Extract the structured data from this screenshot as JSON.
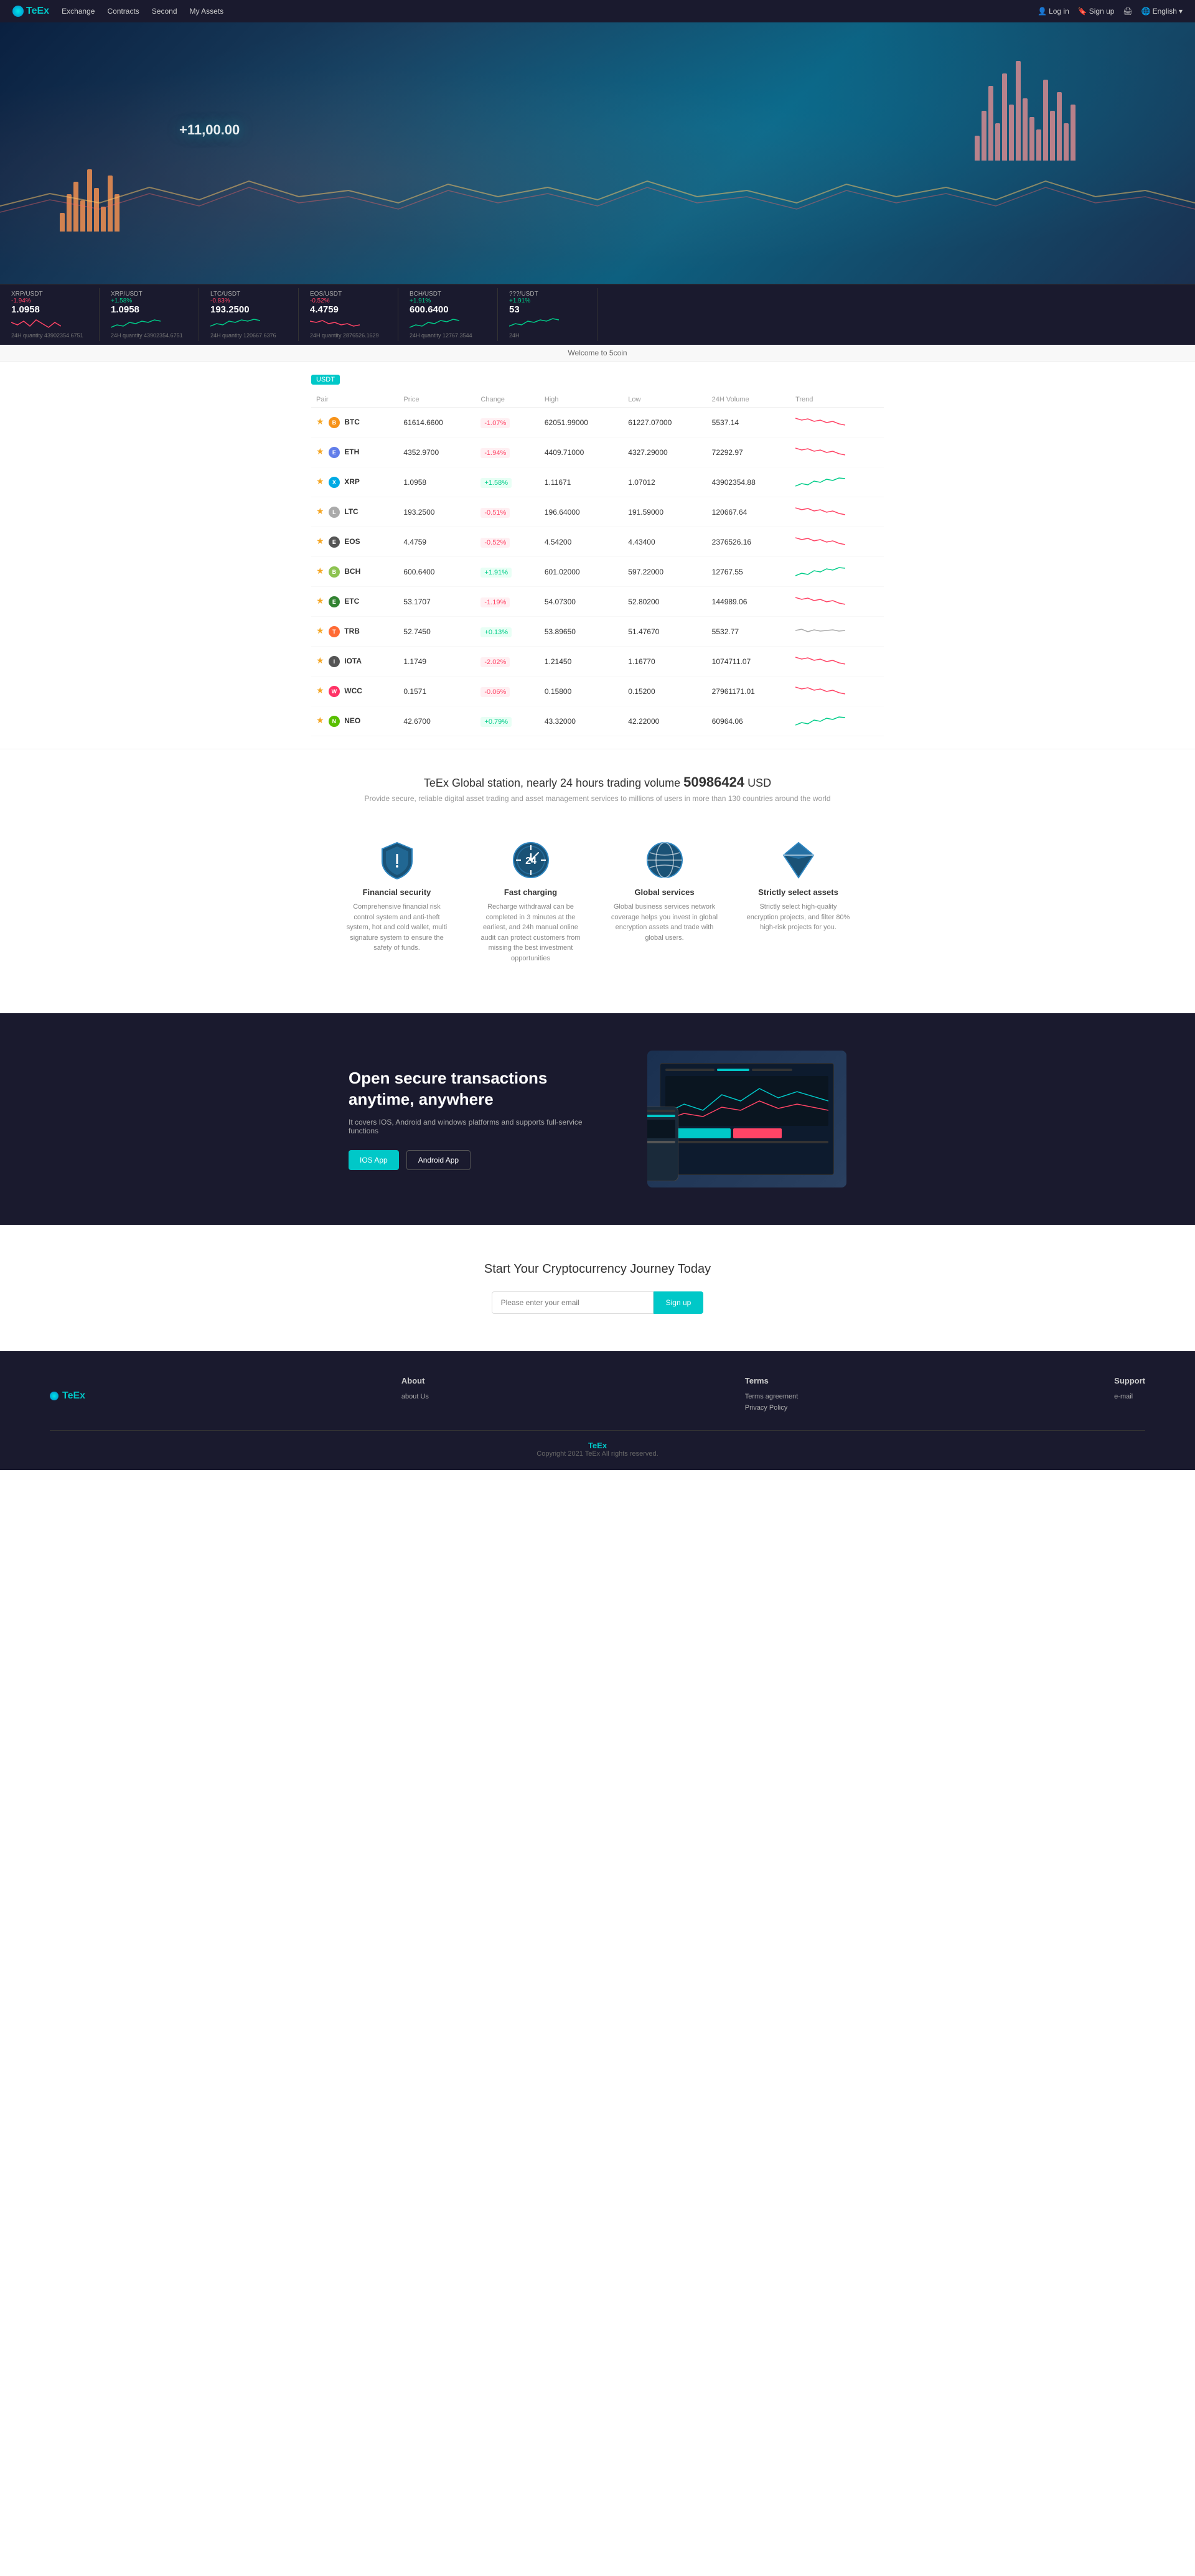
{
  "nav": {
    "logo": "TeEx",
    "links": [
      "Exchange",
      "Contracts",
      "Second",
      "My Assets"
    ],
    "login": "Log in",
    "signup": "Sign up",
    "lang": "English"
  },
  "hero": {
    "price_tag": "+11,00.00"
  },
  "ticker": [
    {
      "pair": "XRP/USDT",
      "change": "-1.94%",
      "price": "1.0958",
      "vol": "24H quantity 43902354.6751",
      "positive": false
    },
    {
      "pair": "XRP/USDT",
      "change": "+1.58%",
      "price": "1.0958",
      "vol": "24H quantity 43902354.6751",
      "positive": true
    },
    {
      "pair": "LTC/USDT",
      "change": "-0.83%",
      "price": "193.2500",
      "vol": "24H quantity 120667.6376",
      "positive": false
    },
    {
      "pair": "EOS/USDT",
      "change": "-0.52%",
      "price": "4.4759",
      "vol": "24H quantity 2876526.1629",
      "positive": false
    },
    {
      "pair": "BCH/USDT",
      "change": "+1.91%",
      "price": "600.6400",
      "vol": "24H quantity 12767.3544",
      "positive": true
    },
    {
      "pair": "???",
      "change": "+1.91%",
      "price": "53",
      "vol": "24H",
      "positive": true
    }
  ],
  "welcome": "Welcome to 5coin",
  "market": {
    "tab": "USDT",
    "headers": [
      "Pair",
      "Price",
      "Change",
      "High",
      "Low",
      "24H Volume",
      "Trend"
    ],
    "rows": [
      {
        "pair": "BTC",
        "color": "#f7931a",
        "price": "61614.6600",
        "change": "-1.07%",
        "positive": false,
        "high": "62051.99000",
        "low": "61227.07000",
        "vol": "5537.14",
        "spark": "neg"
      },
      {
        "pair": "ETH",
        "color": "#627eea",
        "price": "4352.9700",
        "change": "-1.94%",
        "positive": false,
        "high": "4409.71000",
        "low": "4327.29000",
        "vol": "72292.97",
        "spark": "neg"
      },
      {
        "pair": "XRP",
        "color": "#00aae4",
        "price": "1.0958",
        "change": "+1.58%",
        "positive": true,
        "high": "1.11671",
        "low": "1.07012",
        "vol": "43902354.88",
        "spark": "pos"
      },
      {
        "pair": "LTC",
        "color": "#bfbbbb",
        "price": "193.2500",
        "change": "-0.51%",
        "positive": false,
        "high": "196.64000",
        "low": "191.59000",
        "vol": "120667.64",
        "spark": "neg"
      },
      {
        "pair": "EOS",
        "color": "#000000",
        "price": "4.4759",
        "change": "-0.52%",
        "positive": false,
        "high": "4.54200",
        "low": "4.43400",
        "vol": "2376526.16",
        "spark": "neg"
      },
      {
        "pair": "BCH",
        "color": "#8dc351",
        "price": "600.6400",
        "change": "+1.91%",
        "positive": true,
        "high": "601.02000",
        "low": "597.22000",
        "vol": "12767.55",
        "spark": "pos"
      },
      {
        "pair": "ETC",
        "color": "#328332",
        "price": "53.1707",
        "change": "-1.19%",
        "positive": false,
        "high": "54.07300",
        "low": "52.80200",
        "vol": "144989.06",
        "spark": "neg"
      },
      {
        "pair": "TRB",
        "color": "#ff6b35",
        "price": "52.7450",
        "change": "+0.13%",
        "positive": true,
        "high": "53.89650",
        "low": "51.47670",
        "vol": "5532.77",
        "spark": "neu"
      },
      {
        "pair": "IOTA",
        "color": "#242424",
        "price": "1.1749",
        "change": "-2.02%",
        "positive": false,
        "high": "1.21450",
        "low": "1.16770",
        "vol": "1074711.07",
        "spark": "neg"
      },
      {
        "pair": "WCC",
        "color": "#ff3366",
        "price": "0.1571",
        "change": "-0.06%",
        "positive": false,
        "high": "0.15800",
        "low": "0.15200",
        "vol": "27961171.01",
        "spark": "neg"
      },
      {
        "pair": "NEO",
        "color": "#58bf00",
        "price": "42.6700",
        "change": "+0.79%",
        "positive": true,
        "high": "43.32000",
        "low": "42.22000",
        "vol": "60964.06",
        "spark": "pos"
      }
    ]
  },
  "stats": {
    "prefix": "TeEx Global station, nearly 24 hours trading volume ",
    "amount": "50986424",
    "suffix": " USD",
    "subtitle": "Provide secure, reliable digital asset trading and asset management services to millions of users in more than 130 countries around the world"
  },
  "features": [
    {
      "id": "financial-security",
      "title": "Financial security",
      "desc": "Comprehensive financial risk control system and anti-theft system, hot and cold wallet, multi signature system to ensure the safety of funds.",
      "icon": "shield"
    },
    {
      "id": "fast-charging",
      "title": "Fast charging",
      "desc": "Recharge withdrawal can be completed in 3 minutes at the earliest, and 24h manual online audit can protect customers from missing the best investment opportunities",
      "icon": "clock24"
    },
    {
      "id": "global-services",
      "title": "Global services",
      "desc": "Global business services network coverage helps you invest in global encryption assets and trade with global users.",
      "icon": "globe"
    },
    {
      "id": "strictly-select",
      "title": "Strictly select assets",
      "desc": "Strictly select high-quality encryption projects, and filter 80% high-risk projects for you.",
      "icon": "diamond"
    }
  ],
  "dark": {
    "title": "Open secure transactions anytime, anywhere",
    "subtitle": "It covers IOS, Android and windows platforms and supports full-service functions",
    "btn_ios": "IOS App",
    "btn_android": "Android App"
  },
  "cta": {
    "title": "Start Your Cryptocurrency Journey Today",
    "placeholder": "Please enter your email",
    "btn": "Sign up"
  },
  "footer": {
    "logo": "TeEx",
    "about_title": "About",
    "about_links": [
      "about Us"
    ],
    "terms_title": "Terms",
    "terms_links": [
      "Terms agreement",
      "Privacy Policy"
    ],
    "support_title": "Support",
    "support_links": [
      "e-mail"
    ],
    "brand": "TeEx",
    "copyright": "Copyright 2021 TeEx All rights reserved."
  }
}
